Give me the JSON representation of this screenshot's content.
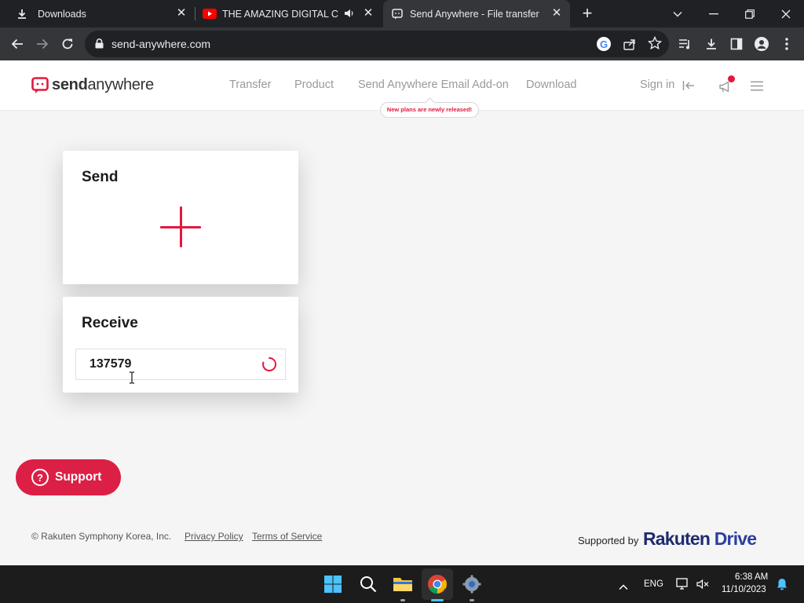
{
  "browser": {
    "tabs": [
      {
        "title": "Downloads",
        "icon": "download-icon",
        "active": false
      },
      {
        "title": "THE AMAZING DIGITAL CIRC",
        "icon": "youtube-icon",
        "audio": true,
        "active": false
      },
      {
        "title": "Send Anywhere - File transfer",
        "icon": "send-anywhere-favicon",
        "active": true
      }
    ],
    "url": "send-anywhere.com"
  },
  "site": {
    "logo": {
      "part1": "send",
      "part2": "anywhere"
    },
    "nav": [
      "Transfer",
      "Product",
      "Send Anywhere Email Add-on",
      "Download"
    ],
    "badge": "New plans are newly released!",
    "signin": "Sign in"
  },
  "send_card": {
    "title": "Send"
  },
  "receive_card": {
    "title": "Receive",
    "key_value": "137579"
  },
  "support": {
    "label": "Support"
  },
  "footer": {
    "copyright": "© Rakuten Symphony Korea, Inc.",
    "privacy": "Privacy Policy",
    "terms": "Terms of Service",
    "supported_by": "Supported by",
    "brand_part1": "Rakuten",
    "brand_part2": "Drive"
  },
  "taskbar": {
    "lang": "ENG",
    "time": "6:38 AM",
    "date": "11/10/2023"
  },
  "colors": {
    "brand_red": "#e5173f",
    "support_red": "#dc1f44",
    "rakuten_blue": "#1e2b6e"
  }
}
